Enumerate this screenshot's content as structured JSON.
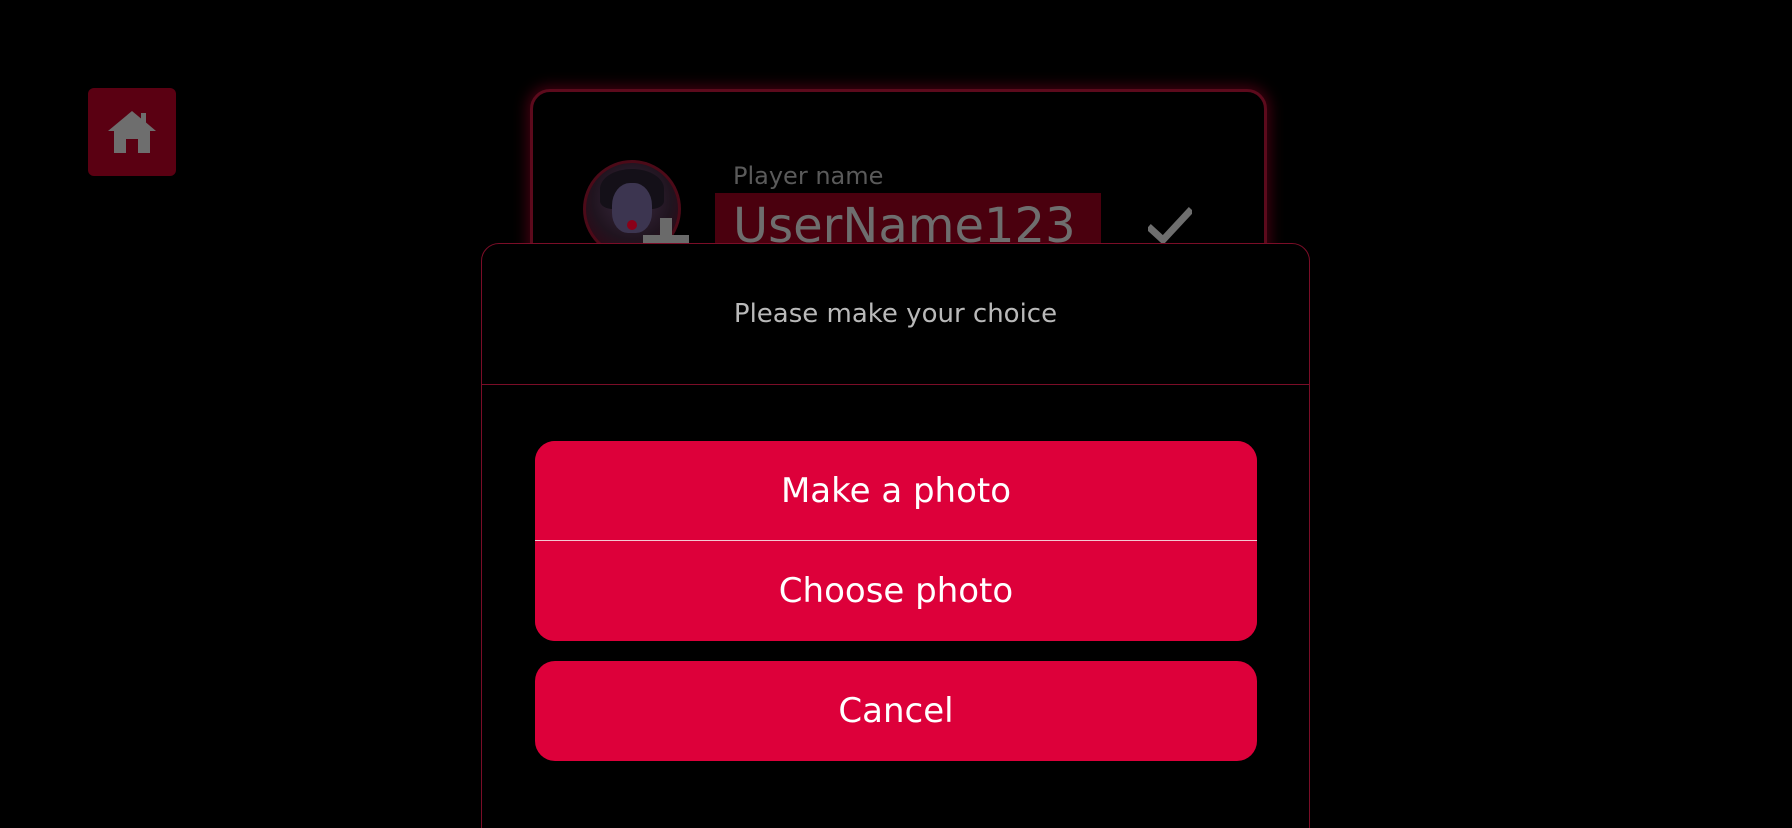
{
  "home": {
    "icon": "home-icon"
  },
  "profile": {
    "player_label": "Player name",
    "name_value": "UserName123",
    "avatar_add_icon": "plus-icon",
    "confirm_icon": "check-icon"
  },
  "dialog": {
    "title": "Please make your choice",
    "make_photo": "Make a photo",
    "choose_photo": "Choose photo",
    "cancel": "Cancel"
  },
  "colors": {
    "background": "#000000",
    "accent": "#dd003a",
    "border": "#7a0d27",
    "home_button": "#5a0012"
  }
}
